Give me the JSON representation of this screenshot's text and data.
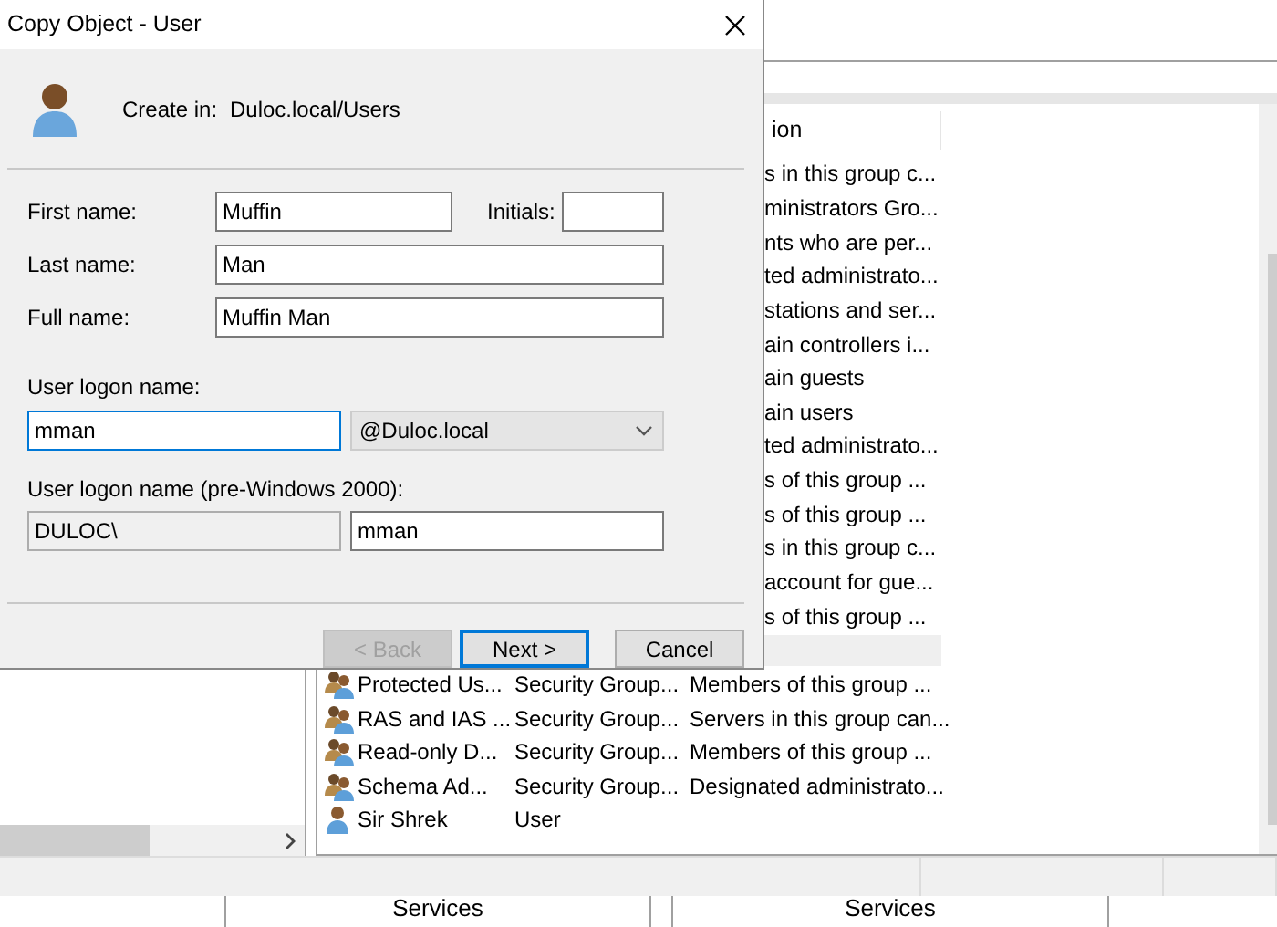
{
  "dialog": {
    "title": "Copy Object - User",
    "create_in_label": "Create in:",
    "create_in_value": "Duloc.local/Users",
    "first_name": {
      "label": "First name:",
      "value": "Muffin"
    },
    "initials": {
      "label": "Initials:"
    },
    "last_name": {
      "label": "Last name:",
      "value": "Man"
    },
    "full_name": {
      "label": "Full name:",
      "value": "Muffin Man"
    },
    "logon": {
      "label": "User logon name:",
      "value": "mman",
      "focused": true,
      "domain": "@Duloc.local"
    },
    "pre2000": {
      "label": "User logon name (pre-Windows 2000):",
      "domain": "DULOC\\",
      "value": "mman"
    },
    "buttons": [
      {
        "label": "< Back",
        "disabled": true,
        "focused": false
      },
      {
        "label": "Next >",
        "disabled": false,
        "focused": true
      },
      {
        "label": "Cancel",
        "disabled": false,
        "focused": false
      }
    ]
  },
  "list": {
    "columns": [
      {
        "label": "ion"
      }
    ],
    "rows": [
      {
        "description": "s in this group c...",
        "selected": false
      },
      {
        "description": "ministrators Gro...",
        "selected": false
      },
      {
        "description": "nts who are per...",
        "selected": false
      },
      {
        "description": "ted administrato...",
        "selected": false
      },
      {
        "description": "stations and ser...",
        "selected": false
      },
      {
        "description": "ain controllers i...",
        "selected": false
      },
      {
        "description": "ain guests",
        "selected": false
      },
      {
        "description": "ain users",
        "selected": false
      },
      {
        "description": "ted administrato...",
        "selected": false
      },
      {
        "description": "s of this group ...",
        "selected": false
      },
      {
        "description": "s of this group ...",
        "selected": false
      },
      {
        "description": "s in this group c...",
        "selected": false
      },
      {
        "description": "account for gue...",
        "selected": false
      },
      {
        "description": "s of this group ...",
        "selected": false
      },
      {
        "selected": true
      },
      {
        "kind": "group",
        "name": "Protected Us...",
        "type": "Security Group...",
        "description": "Members of this group ...",
        "selected": false
      },
      {
        "kind": "group",
        "name": "RAS and IAS ...",
        "type": "Security Group...",
        "description": "Servers in this group can...",
        "selected": false
      },
      {
        "kind": "group",
        "name": "Read-only D...",
        "type": "Security Group...",
        "description": "Members of this group ...",
        "selected": false
      },
      {
        "kind": "group",
        "name": "Schema Ad...",
        "type": "Security Group...",
        "description": "Designated administrato...",
        "selected": false
      },
      {
        "kind": "user",
        "name": "Sir Shrek",
        "type": "User",
        "selected": false
      }
    ]
  },
  "taskbar": {
    "items": [
      "Services",
      "Services"
    ]
  }
}
